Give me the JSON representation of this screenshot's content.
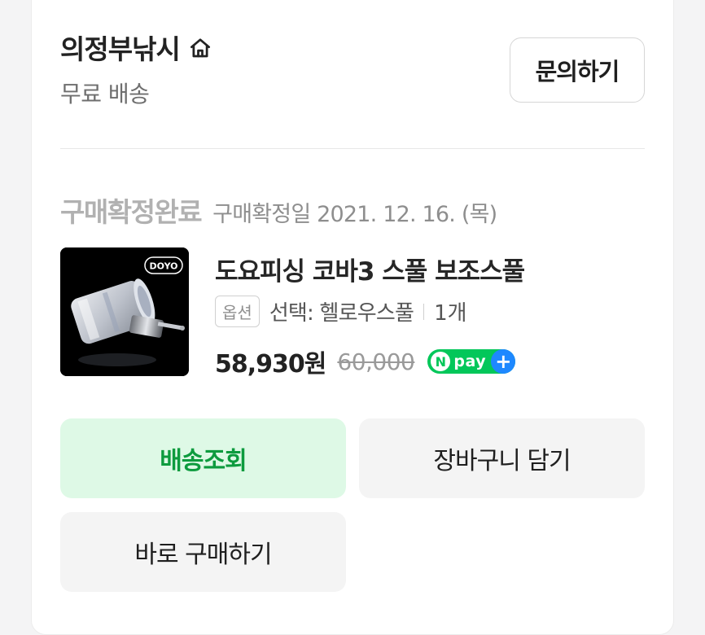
{
  "seller": {
    "name": "의정부낚시",
    "shipping": "무료 배송",
    "inquiry_button": "문의하기"
  },
  "order": {
    "status": "구매확정완료",
    "confirm_date": "구매확정일 2021. 12. 16. (목)"
  },
  "product": {
    "name": "도요피싱 코바3 스풀 보조스풀",
    "thumbnail_brand": "DOYO",
    "option_badge": "옵션",
    "option_text": "선택: 헬로우스풀",
    "quantity": "1개",
    "price": "58,930원",
    "original_price": "60,000",
    "npay_label": "pay",
    "npay_letter": "N",
    "npay_plus": "+"
  },
  "actions": {
    "track_shipping": "배송조회",
    "add_to_cart": "장바구니 담기",
    "buy_now": "바로 구매하기"
  },
  "colors": {
    "accent_green": "#03c75a",
    "track_bg": "#def9e6",
    "track_text": "#0d9b3e",
    "npay_plus_blue": "#1e88ff"
  }
}
